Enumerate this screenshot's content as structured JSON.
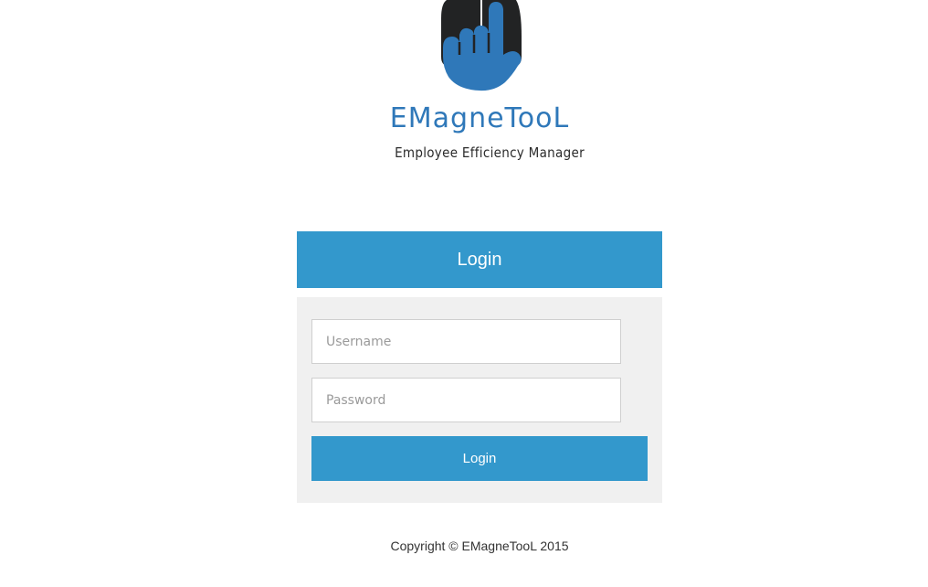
{
  "brand": {
    "name": "EMagneTooL",
    "tagline": "Employee Efficiency Manager",
    "logo_icon": "hand-pointer-mouse-icon",
    "primary_color": "#3398cc",
    "brand_text_color": "#2f78b9"
  },
  "login": {
    "header_title": "Login",
    "username_placeholder": "Username",
    "username_value": "",
    "password_placeholder": "Password",
    "password_value": "",
    "submit_label": "Login"
  },
  "footer": {
    "copyright": "Copyright © EMagneTooL 2015"
  }
}
